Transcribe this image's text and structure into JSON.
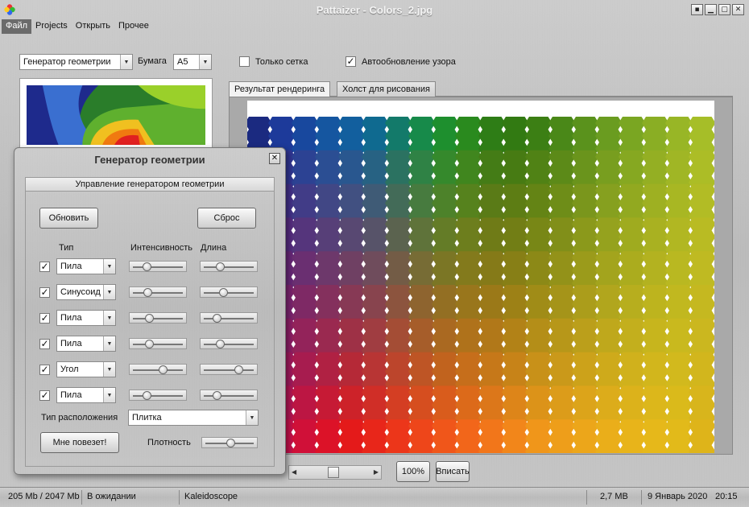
{
  "window": {
    "title": "Pattaizer - Colors_2.jpg",
    "buttons": [
      "▪",
      "▁",
      "▢",
      "✕"
    ]
  },
  "menu": [
    "Файл",
    "Projects",
    "Открыть",
    "Прочее"
  ],
  "toolbar": {
    "generator_combo": "Генератор геометрии",
    "paper_label": "Бумага",
    "paper_combo": "А5",
    "grid_only_label": "Только сетка",
    "grid_only_checked": false,
    "auto_update_label": "Автообновление узора",
    "auto_update_checked": true
  },
  "tabs": [
    "Результат рендеринга",
    "Холст для рисования"
  ],
  "zoom": {
    "zoom_100_label": "100%",
    "fit_label": "Вписать"
  },
  "status": {
    "memory": "205 Mb / 2047 Mb",
    "state": "В ожидании",
    "mode": "Kaleidoscope",
    "size": "2,7 MB",
    "date": "9 Январь 2020",
    "time": "20:15"
  },
  "dialog": {
    "title": "Генератор геометрии",
    "close": "✕",
    "group_header": "Управление генератором геометрии",
    "refresh_label": "Обновить",
    "reset_label": "Сброс",
    "col_type": "Тип",
    "col_intensity": "Интенсивность",
    "col_length": "Длина",
    "rows": [
      {
        "checked": true,
        "type": "Пила",
        "intensity": 0.22,
        "length": 0.28
      },
      {
        "checked": true,
        "type": "Синусоид",
        "intensity": 0.25,
        "length": 0.35
      },
      {
        "checked": true,
        "type": "Пила",
        "intensity": 0.28,
        "length": 0.2
      },
      {
        "checked": true,
        "type": "Пила",
        "intensity": 0.28,
        "length": 0.28
      },
      {
        "checked": true,
        "type": "Угол",
        "intensity": 0.6,
        "length": 0.72
      },
      {
        "checked": true,
        "type": "Пила",
        "intensity": 0.22,
        "length": 0.2
      }
    ],
    "layout_label": "Тип расположения",
    "layout_value": "Плитка",
    "lucky_label": "Мне повезет!",
    "density_label": "Плотность",
    "density": 0.5
  },
  "colors": {
    "menu_active": "#6b6b6b",
    "canvas_bg": "#ffffff"
  }
}
